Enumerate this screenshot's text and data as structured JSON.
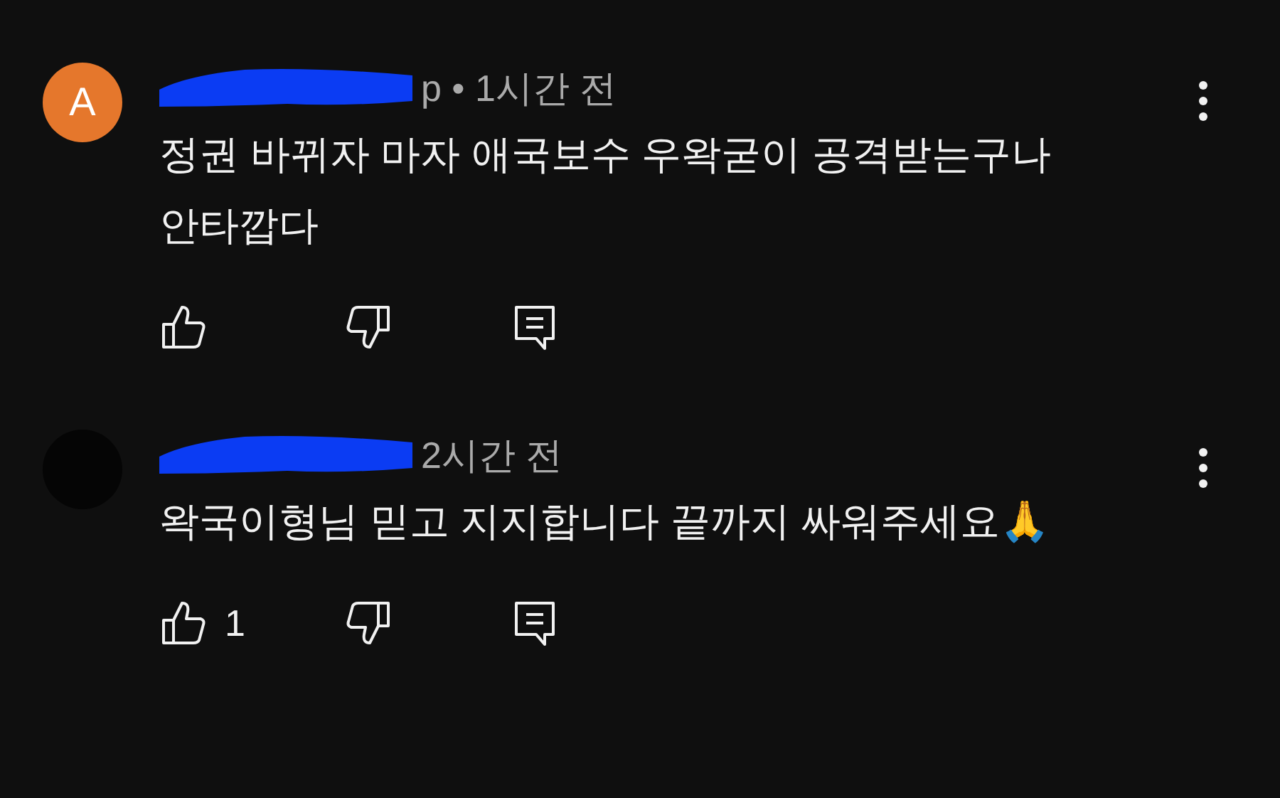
{
  "comments": [
    {
      "avatar": {
        "letter": "A",
        "color": "#e5772c"
      },
      "meta": "p • 1시간 전",
      "text": "정권 바뀌자 마자 애국보수 우왁굳이 공격받는구나 안타깝다"
    },
    {
      "avatar": {
        "color": "#050505"
      },
      "meta": "2시간 전",
      "text": "왁국이형님 믿고 지지합니다 끝까지 싸워주세요🙏",
      "likes": "1"
    }
  ]
}
